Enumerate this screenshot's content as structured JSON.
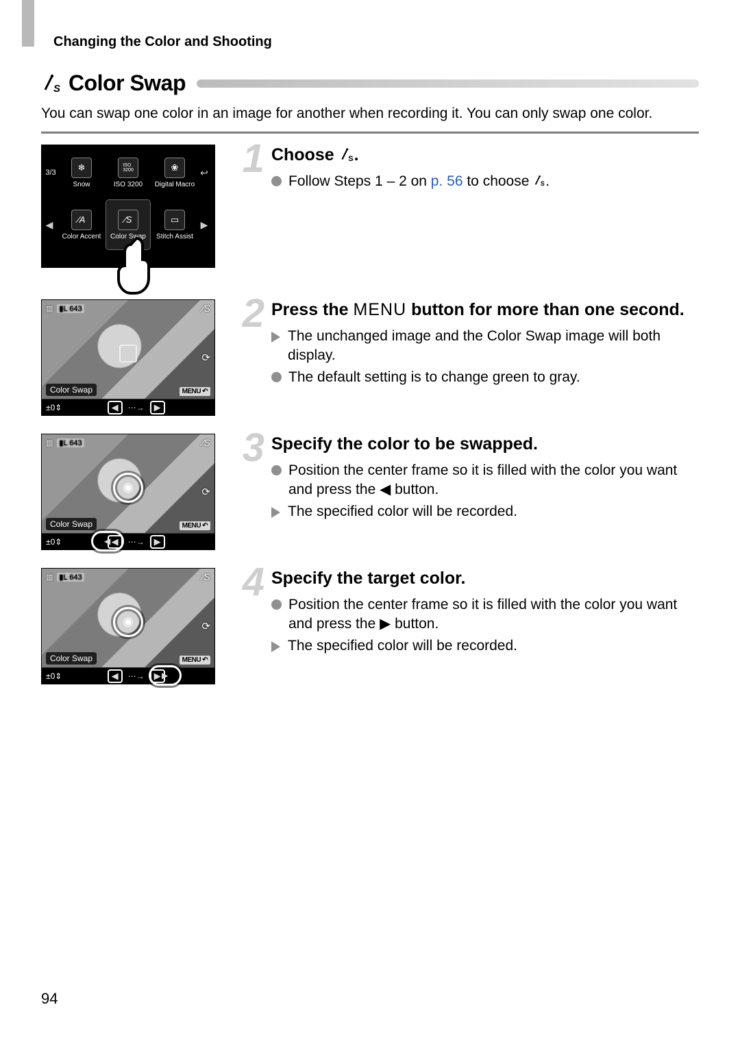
{
  "running_head": "Changing the Color and Shooting",
  "section": {
    "icon_label": "Y",
    "title": "Color Swap",
    "intro": "You can swap one color in an image for another when recording it. You can only swap one color."
  },
  "menu": {
    "page_indicator": "3/3",
    "items": [
      {
        "icon": "❄",
        "label": "Snow"
      },
      {
        "icon": "ISO\n3200",
        "label": "ISO 3200"
      },
      {
        "icon": "🌷",
        "label": "Digital Macro"
      },
      {
        "icon": "⁄A",
        "label": "Color Accent"
      },
      {
        "icon": "⁄S",
        "label": "Color Swap"
      },
      {
        "icon": "▭",
        "label": "Stitch Assist"
      }
    ]
  },
  "lcd": {
    "shots": "643",
    "mode_label": "Color Swap",
    "menu_btn": "MENU",
    "exp": "±0",
    "top_right_icon": "⁄S",
    "mid_right_icon": "↻",
    "battery_icon": "▮▮▮"
  },
  "steps": [
    {
      "num": "1",
      "title_pre": "Choose ",
      "title_icon": "⁄S",
      "title_post": ".",
      "bullets": [
        {
          "type": "circ",
          "pre": "Follow Steps 1 – 2 on ",
          "ref": "p. 56",
          "post": " to choose ",
          "icon": "⁄S",
          "tail": "."
        }
      ]
    },
    {
      "num": "2",
      "title_pre": "Press the ",
      "title_menu": "MENU",
      "title_post": " button for more than one second.",
      "bullets": [
        {
          "type": "tri",
          "text": "The unchanged image and the Color Swap image will both display."
        },
        {
          "type": "circ",
          "text": "The default setting is to change green to gray."
        }
      ]
    },
    {
      "num": "3",
      "title": "Specify the color to be swapped.",
      "bullets": [
        {
          "type": "circ",
          "pre": "Position the center frame so it is filled with the color you want and press the ",
          "btn": "◀",
          "post": " button."
        },
        {
          "type": "tri",
          "text": "The specified color will be recorded."
        }
      ]
    },
    {
      "num": "4",
      "title": "Specify the target color.",
      "bullets": [
        {
          "type": "circ",
          "pre": "Position the center frame so it is filled with the color you want and press the ",
          "btn": "▶",
          "post": " button."
        },
        {
          "type": "tri",
          "text": "The specified color will be recorded."
        }
      ]
    }
  ],
  "page_number": "94"
}
